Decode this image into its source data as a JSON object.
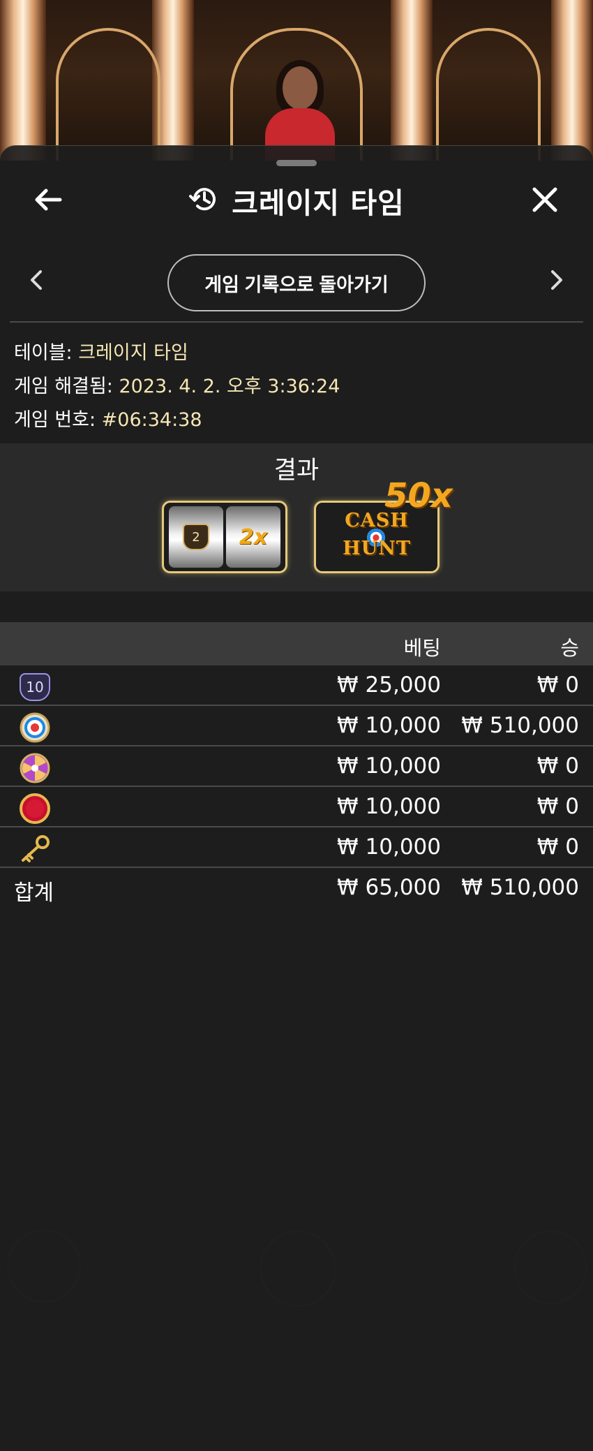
{
  "header": {
    "title": "크레이지 타임",
    "back_label": "게임 기록으로 돌아가기"
  },
  "info": {
    "table_label": "테이블:",
    "table_value": "크레이지 타임",
    "resolved_label": "게임 해결됨:",
    "resolved_value": "2023. 4. 2. 오후 3:36:24",
    "game_no_label": "게임 번호:",
    "game_no_value": "#06:34:38"
  },
  "result": {
    "title": "결과",
    "slot": {
      "segment": "2",
      "multiplier": "2x"
    },
    "outcome": {
      "line1": "CASH",
      "line2": "HUNT",
      "multiplier": "50x"
    }
  },
  "table": {
    "col_bet": "베팅",
    "col_win": "승",
    "rows": [
      {
        "icon": "number-10-icon",
        "label": "10",
        "bet": "₩ 25,000",
        "win": "₩ 0"
      },
      {
        "icon": "cash-hunt-icon",
        "bet": "₩ 10,000",
        "win": "₩ 510,000"
      },
      {
        "icon": "pachinko-icon",
        "bet": "₩ 10,000",
        "win": "₩ 0"
      },
      {
        "icon": "coin-flip-icon",
        "bet": "₩ 10,000",
        "win": "₩ 0"
      },
      {
        "icon": "crazy-time-key-icon",
        "bet": "₩ 10,000",
        "win": "₩ 0"
      }
    ],
    "total": {
      "label": "합계",
      "bet": "₩ 65,000",
      "win": "₩ 510,000"
    }
  },
  "colors": {
    "accent_value": "#f6e6b4",
    "gold": "#e6c97a",
    "sheet_bg": "#1e1e1e",
    "header_row_bg": "#3b3b3b"
  }
}
